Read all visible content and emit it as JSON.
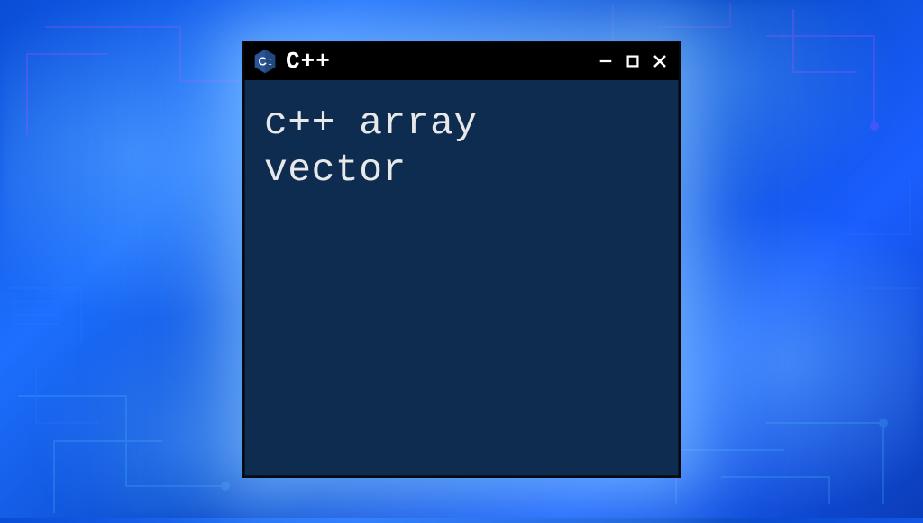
{
  "window": {
    "title": "C++",
    "icon": "cpp-hexagon-icon"
  },
  "terminal": {
    "line1": "c++ array",
    "line2": "vector"
  },
  "colors": {
    "terminal_bg": "#0d2c50",
    "titlebar_bg": "#000000",
    "text": "#e8e8e8",
    "glow": "#8cc8ff"
  }
}
